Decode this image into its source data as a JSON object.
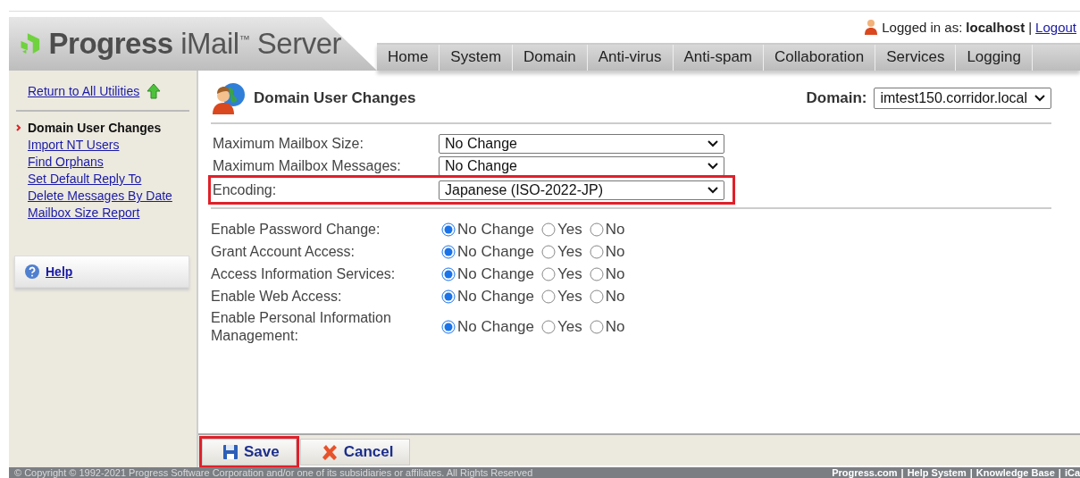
{
  "header": {
    "logo": {
      "brand": "Progress",
      "product": "iMail$^{™}$ Server"
    },
    "user": {
      "label": "Logged in as:",
      "name": "localhost",
      "separator": "|",
      "logout": "Logout"
    },
    "tabs": [
      {
        "label": "Home",
        "selected": false
      },
      {
        "label": "System",
        "selected": false
      },
      {
        "label": "Domain",
        "selected": false
      },
      {
        "label": "Anti-virus",
        "selected": false
      },
      {
        "label": "Anti-spam",
        "selected": false
      },
      {
        "label": "Collaboration",
        "selected": false
      },
      {
        "label": "Services",
        "selected": false
      },
      {
        "label": "Logging",
        "selected": false
      }
    ]
  },
  "sidebar": {
    "back_link": "Return to All Utilities",
    "items": [
      {
        "label": "Domain User Changes",
        "selected": true
      },
      {
        "label": "Import NT Users",
        "selected": false
      },
      {
        "label": "Find Orphans",
        "selected": false
      },
      {
        "label": "Set Default Reply To",
        "selected": false
      },
      {
        "label": "Delete Messages By Date",
        "selected": false
      },
      {
        "label": "Mailbox Size Report",
        "selected": false
      }
    ],
    "help": "Help"
  },
  "content": {
    "title": "Domain User Changes",
    "domain": {
      "label": "Domain:",
      "value": "imtest150.corridor.local"
    },
    "selects": [
      {
        "label": "Maximum Mailbox Size:",
        "value": "No Change",
        "highlighted": false
      },
      {
        "label": "Maximum Mailbox Messages:",
        "value": "No Change",
        "highlighted": false
      },
      {
        "label": "Encoding:",
        "value": "Japanese (ISO-2022-JP)",
        "highlighted": true
      }
    ],
    "radios": [
      {
        "label": "Enable Password Change:",
        "options": [
          {
            "label": "No Change",
            "selected": true
          },
          {
            "label": "Yes",
            "selected": false
          },
          {
            "label": "No",
            "selected": false
          }
        ]
      },
      {
        "label": "Grant Account Access:",
        "options": [
          {
            "label": "No Change",
            "selected": true
          },
          {
            "label": "Yes",
            "selected": false
          },
          {
            "label": "No",
            "selected": false
          }
        ]
      },
      {
        "label": "Access Information Services:",
        "options": [
          {
            "label": "No Change",
            "selected": true
          },
          {
            "label": "Yes",
            "selected": false
          },
          {
            "label": "No",
            "selected": false
          }
        ]
      },
      {
        "label": "Enable Web Access:",
        "options": [
          {
            "label": "No Change",
            "selected": true
          },
          {
            "label": "Yes",
            "selected": false
          },
          {
            "label": "No",
            "selected": false
          }
        ]
      },
      {
        "label": "Enable Personal Information Management:",
        "options": [
          {
            "label": "No Change",
            "selected": true
          },
          {
            "label": "Yes",
            "selected": false
          },
          {
            "label": "No",
            "selected": false
          }
        ]
      }
    ],
    "buttons": [
      {
        "kind": "save",
        "label": "Save",
        "highlighted": true
      },
      {
        "kind": "cancel",
        "label": "Cancel",
        "highlighted": false
      }
    ]
  },
  "footer": {
    "copyright": "© Copyright © 1992-2021 Progress Software Corporation and/or one of its subsidiaries or affiliates. All Rights Reserved",
    "separator": "|",
    "links": [
      "Progress.com",
      "Help System",
      "Knowledge Base",
      "iCa"
    ]
  }
}
